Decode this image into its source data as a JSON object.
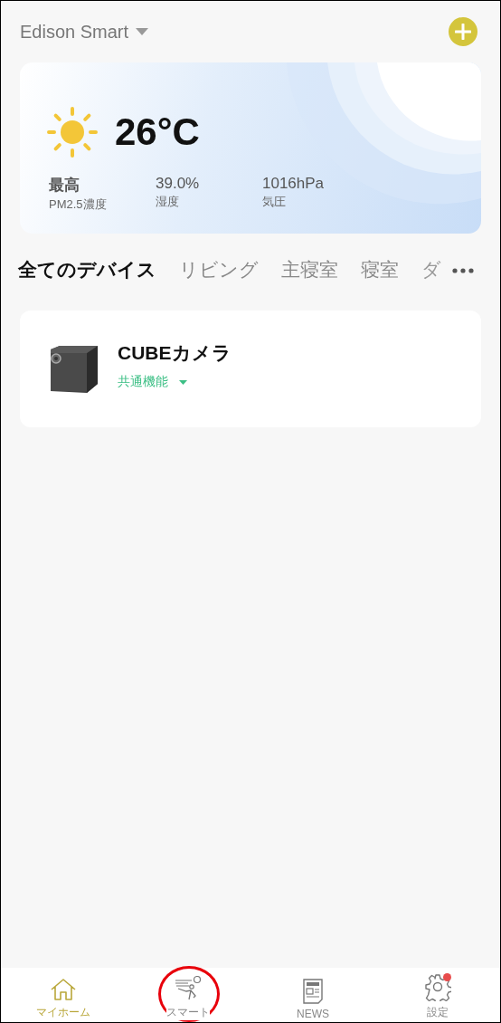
{
  "header": {
    "home_name": "Edison Smart"
  },
  "weather": {
    "temperature": "26°C",
    "stats": [
      {
        "value": "最高",
        "label": "PM2.5濃度"
      },
      {
        "value": "39.0%",
        "label": "湿度"
      },
      {
        "value": "1016hPa",
        "label": "気圧"
      }
    ]
  },
  "room_tabs": [
    {
      "label": "全てのデバイス",
      "selected": true
    },
    {
      "label": "リビング",
      "selected": false
    },
    {
      "label": "主寝室",
      "selected": false
    },
    {
      "label": "寝室",
      "selected": false
    },
    {
      "label": "ダ",
      "selected": false
    }
  ],
  "devices": [
    {
      "name": "CUBEカメラ",
      "function_menu": "共通機能"
    }
  ],
  "bottom_nav": [
    {
      "label": "マイホーム",
      "selected": true,
      "badge": false
    },
    {
      "label": "スマート",
      "selected": false,
      "badge": false
    },
    {
      "label": "NEWS",
      "selected": false,
      "badge": false
    },
    {
      "label": "設定",
      "selected": false,
      "badge": true
    }
  ]
}
